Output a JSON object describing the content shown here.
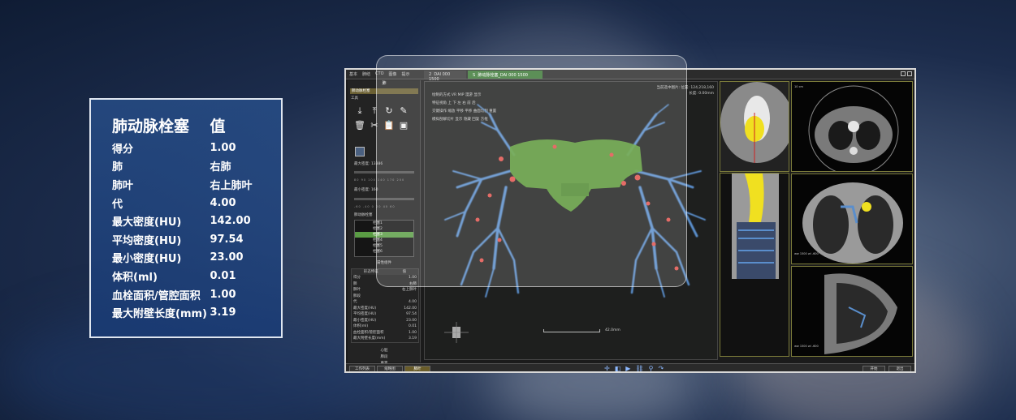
{
  "info_panel": {
    "header_label": "肺动脉栓塞",
    "header_value": "值",
    "rows": [
      {
        "label": "得分",
        "unit": "",
        "value": "1.00"
      },
      {
        "label": "肺",
        "unit": "",
        "value": "右肺"
      },
      {
        "label": "肺叶",
        "unit": "",
        "value": "右上肺叶"
      },
      {
        "label": "代",
        "unit": "",
        "value": "4.00"
      },
      {
        "label": "最大密度",
        "unit": "(HU)",
        "value": "142.00"
      },
      {
        "label": "平均密度",
        "unit": "(HU)",
        "value": "97.54"
      },
      {
        "label": "最小密度",
        "unit": "(HU)",
        "value": "23.00"
      },
      {
        "label": "体积",
        "unit": "(ml)",
        "value": "0.01"
      },
      {
        "label": "血栓面积/管腔面积",
        "unit": "",
        "value": "1.00"
      },
      {
        "label": "最大附壁长度",
        "unit": "(mm)",
        "value": "3.19"
      }
    ]
  },
  "app": {
    "menu": [
      "基本",
      "肺结",
      "CTO",
      "图像",
      "提示"
    ],
    "tabs": [
      {
        "icon": "2",
        "label": "DAI 000 1500"
      },
      {
        "icon": "S",
        "label": "肺动脉栓塞_DAI 000 1500"
      }
    ],
    "sidebar": {
      "title": "肺",
      "select_value": "肺动脉栓塞",
      "tools_label": "工具",
      "tools": [
        "⤓",
        "⤒",
        "↻",
        "✎",
        "🗑",
        "✂",
        "📋",
        "▣"
      ],
      "max_density_label": "最大密度: 13386",
      "min_density_label": "最小密度: 160",
      "ticks_top": "80  90  100  140  170  200",
      "ticks_bottom": "-60  -40   0   20   40   60",
      "list_label": "肺动脉栓塞",
      "list_items": [
        "栓塞1",
        "栓塞2",
        "栓塞3",
        "栓塞4",
        "栓塞5",
        "栓塞6"
      ],
      "selected_index": 2,
      "attr_title": "属性组件",
      "attr_headers": [
        "形态特征",
        "值"
      ],
      "attr_rows": [
        {
          "k": "得分",
          "v": "1.00"
        },
        {
          "k": "肺",
          "v": "右肺"
        },
        {
          "k": "肺叶",
          "v": "右上肺叶"
        },
        {
          "k": "肺段",
          "v": ""
        },
        {
          "k": "代",
          "v": "4.00"
        },
        {
          "k": "最大密度(HU)",
          "v": "142.00"
        },
        {
          "k": "平均密度(HU)",
          "v": "97.54"
        },
        {
          "k": "最小密度(HU)",
          "v": "23.00"
        },
        {
          "k": "体积(ml)",
          "v": "0.01"
        },
        {
          "k": "血栓面积/管腔面积",
          "v": "1.00"
        },
        {
          "k": "最大附壁长度(mm)",
          "v": "3.19"
        }
      ],
      "actions": [
        "心脏",
        "肺段",
        "重置"
      ]
    },
    "viewport": {
      "options": [
        "绘制的方式  VR  MIP  漫游  显示",
        "特征视角  上  下  左  右  前  后",
        "交键操作  缩放  平移  平移  曲面切割  重置",
        "模拟剖解切片  显示  隐藏  回复  方框"
      ],
      "info_line1": "当前选中图片: 位置: 124,218,160",
      "info_line2": "长度: 0.00mm",
      "scale_label": "42.0mm"
    },
    "panels": {
      "axial_info": "10 cm",
      "coronal_info": "ww 1500 wl -600",
      "sagittal_info": "ww 1500 wl -600"
    },
    "bottom": {
      "left_buttons": [
        "工作列表",
        "缩略图",
        "肺叶"
      ],
      "active_index": 2,
      "right_buttons": [
        "开始",
        "退出"
      ]
    }
  },
  "colors": {
    "panel_bg": "#2a5090",
    "vessel_blue": "#5a8ecc",
    "heart_green": "#5fa03a",
    "clot_red": "#e0504a",
    "highlight_yellow": "#f0e020"
  }
}
